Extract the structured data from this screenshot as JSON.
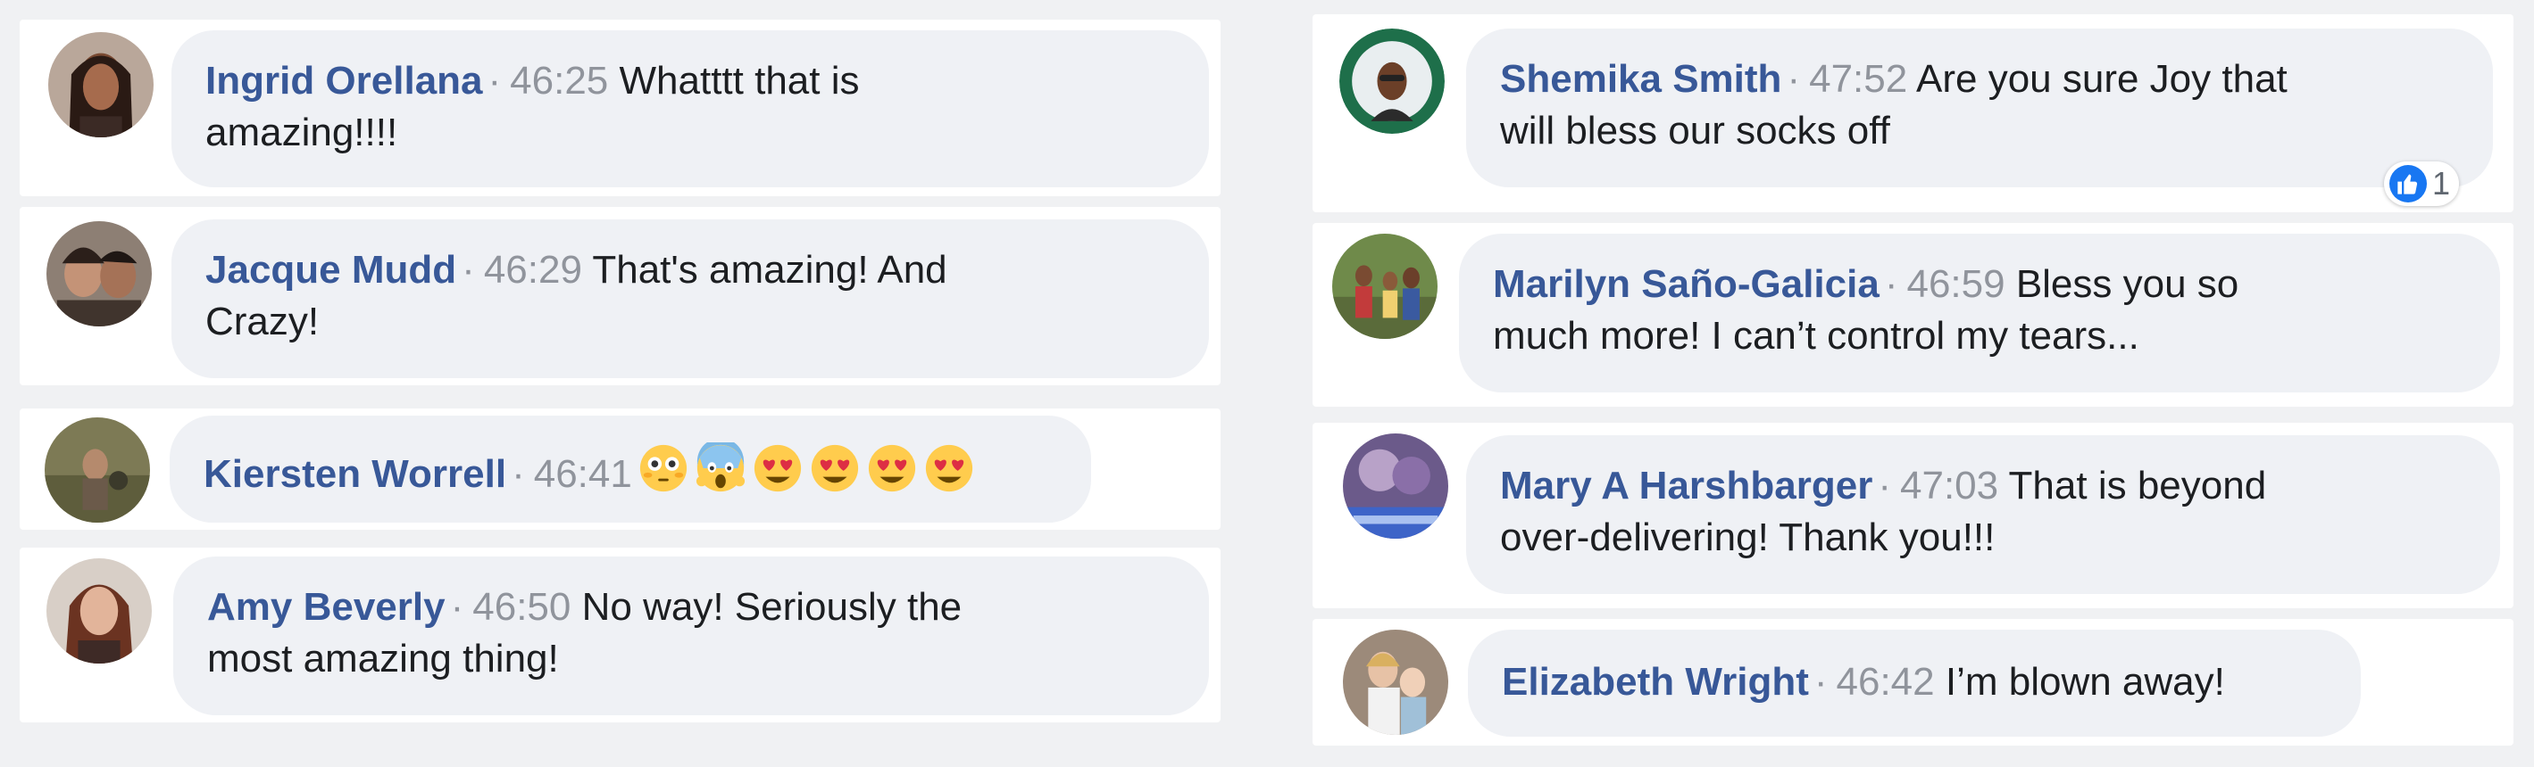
{
  "comments": [
    {
      "name": "Ingrid Orellana",
      "time": "46:25",
      "line1": "Whatttt that is",
      "line2": "amazing!!!!"
    },
    {
      "name": "Jacque Mudd",
      "time": "46:29",
      "line1": "That's amazing! And",
      "line2": "Crazy!"
    },
    {
      "name": "Kiersten Worrell",
      "time": "46:41",
      "emoji": [
        "flushed-face",
        "face-screaming-in-fear",
        "heart-eyes",
        "heart-eyes",
        "heart-eyes",
        "heart-eyes"
      ]
    },
    {
      "name": "Amy Beverly",
      "time": "46:50",
      "line1": "No way! Seriously the",
      "line2": "most amazing thing!"
    },
    {
      "name": "Shemika Smith",
      "time": "47:52",
      "line1": "Are you sure Joy that",
      "line2": "will bless our socks off",
      "reaction_count": "1",
      "reaction_icon": "thumbs-up-icon"
    },
    {
      "name": "Marilyn Saño-Galicia",
      "time": "46:59",
      "line1": "Bless you so",
      "line2": "much more! I can’t control my tears..."
    },
    {
      "name": "Mary A Harshbarger",
      "time": "47:03",
      "line1": "That is beyond",
      "line2": "over-delivering! Thank you!!!"
    },
    {
      "name": "Elizabeth Wright",
      "time": "46:42",
      "line1": "I’m blown away!"
    }
  ],
  "separator": "·",
  "colors": {
    "name": "#385898",
    "timestamp": "#90949c",
    "bubble": "#eff1f5",
    "like": "#1877f2"
  }
}
